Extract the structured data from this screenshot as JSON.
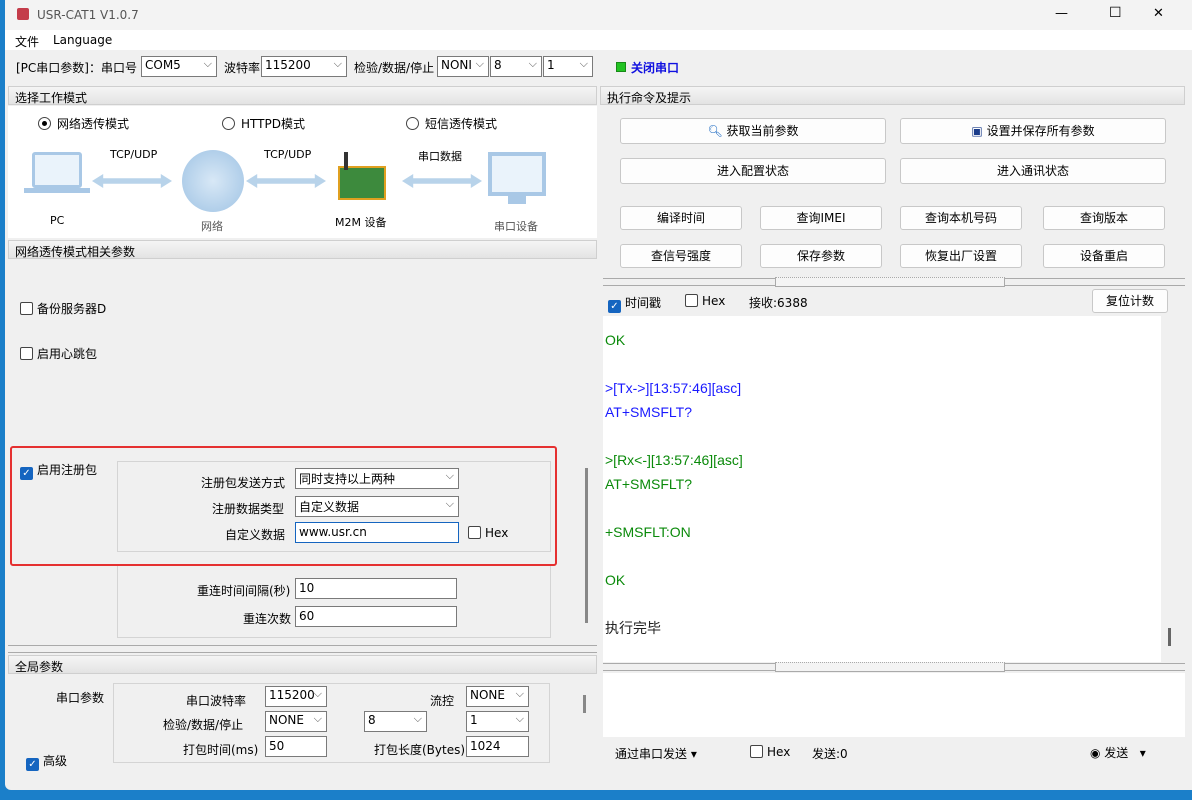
{
  "window": {
    "title": "USR-CAT1 V1.0.7",
    "minimize": "—",
    "maximize": "☐",
    "close": "✕"
  },
  "menu": [
    "文件",
    "Language"
  ],
  "toolbar": {
    "pc_label": "[PC串口参数]：串口号",
    "port": "COM5",
    "baud_label": "波特率",
    "baud": "115200",
    "cds_label": "检验/数据/停止",
    "parity": "NONI",
    "data_bits": "8",
    "stop_bits": "1",
    "close_port": "关闭串口",
    "status_color": "#22c322"
  },
  "work_mode": {
    "header": "选择工作模式",
    "modes": [
      {
        "label": "网络透传模式",
        "selected": true
      },
      {
        "label": "HTTPD模式",
        "selected": false
      },
      {
        "label": "短信透传模式",
        "selected": false
      }
    ],
    "diagram": {
      "link1": "TCP/UDP",
      "link2": "TCP/UDP",
      "link3": "串口数据",
      "pc": "PC",
      "net": "网络",
      "m2m": "M2M 设备",
      "serial": "串口设备"
    }
  },
  "net_params": {
    "header": "网络透传模式相关参数",
    "backup_server": "备份服务器D",
    "heartbeat": "启用心跳包",
    "register": "启用注册包",
    "send_mode_label": "注册包发送方式",
    "send_mode": "同时支持以上两种",
    "data_type_label": "注册数据类型",
    "data_type": "自定义数据",
    "custom_label": "自定义数据",
    "custom": "www.usr.cn",
    "hex": "Hex",
    "reconnect_label": "重连时间间隔(秒)",
    "reconnect": "10",
    "retry_label": "重连次数",
    "retry": "60"
  },
  "global": {
    "header": "全局参数",
    "serial_label": "串口参数",
    "baud_label": "串口波特率",
    "baud": "115200",
    "flow_label": "流控",
    "flow": "NONE",
    "cds_label": "检验/数据/停止",
    "parity": "NONE",
    "data_bits": "8",
    "stop_bits": "1",
    "pack_time_label": "打包时间(ms)",
    "pack_time": "50",
    "pack_len_label": "打包长度(Bytes)",
    "pack_len": "1024",
    "advanced": "高级"
  },
  "commands": {
    "header": "执行命令及提示",
    "get_params": "获取当前参数",
    "save_all": "设置并保存所有参数",
    "enter_config": "进入配置状态",
    "enter_comm": "进入通讯状态",
    "buttons": [
      "编译时间",
      "查询IMEI",
      "查询本机号码",
      "查询版本",
      "查信号强度",
      "保存参数",
      "恢复出厂设置",
      "设备重启"
    ]
  },
  "log_bar": {
    "timestamp": "时间戳",
    "hex": "Hex",
    "recv": "接收:6388",
    "reset": "复位计数"
  },
  "log": [
    {
      "t": "OK",
      "c": "#0a8a0a"
    },
    {
      "t": "",
      "c": "#000"
    },
    {
      "t": ">[Tx->][13:57:46][asc]",
      "c": "#1a1aff"
    },
    {
      "t": "AT+SMSFLT?",
      "c": "#1a1aff"
    },
    {
      "t": "",
      "c": "#000"
    },
    {
      "t": ">[Rx<-][13:57:46][asc]",
      "c": "#0a8a0a"
    },
    {
      "t": "AT+SMSFLT?",
      "c": "#0a8a0a"
    },
    {
      "t": "",
      "c": "#000"
    },
    {
      "t": "+SMSFLT:ON",
      "c": "#0a8a0a"
    },
    {
      "t": "",
      "c": "#000"
    },
    {
      "t": "OK",
      "c": "#0a8a0a"
    },
    {
      "t": "",
      "c": "#000"
    },
    {
      "t": "执行完毕",
      "c": "#222"
    }
  ],
  "send_bar": {
    "mode": "通过串口发送",
    "hex": "Hex",
    "sent": "发送:0",
    "send": "发送"
  }
}
